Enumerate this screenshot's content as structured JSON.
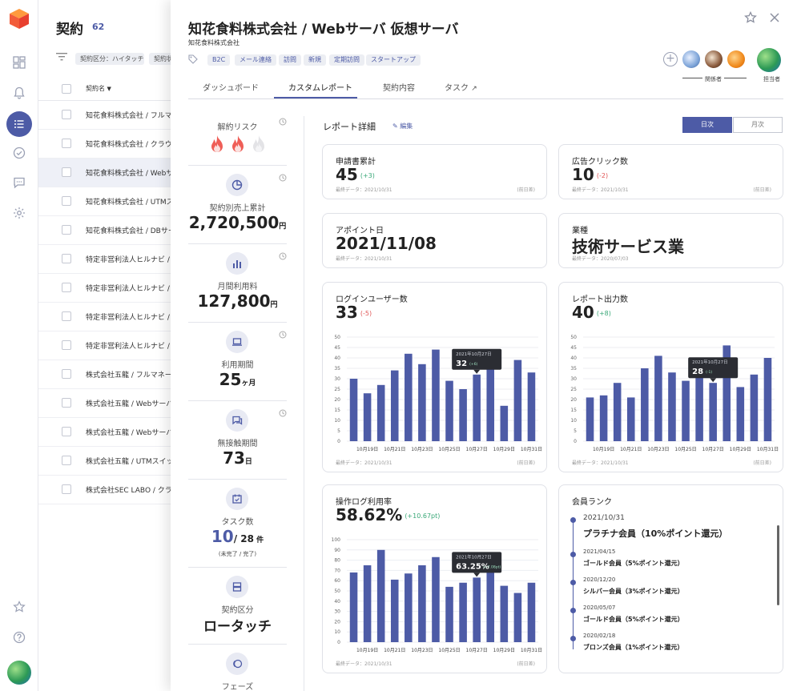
{
  "sidebar": {
    "icons": [
      "logo-cube-icon",
      "dashboard-grid-icon",
      "bell-icon",
      "list-icon",
      "check-circle-icon",
      "chat-icon",
      "gear-icon",
      "star-icon",
      "help-icon",
      "user-avatar"
    ]
  },
  "list": {
    "title": "契約",
    "count": "62",
    "filters": [
      "契約区分：ハイタッチ",
      "契約状"
    ],
    "column_header": "契約名",
    "rows": [
      "知花食料株式会社 / フルマネ",
      "知花食料株式会社 / クラウ",
      "知花食料株式会社 / Webサ",
      "知花食料株式会社 / UTMス",
      "知花食料株式会社 / DBサー",
      "特定非営利法人ヒルナビ / ",
      "特定非営利法人ヒルナビ / ",
      "特定非営利法人ヒルナビ / ",
      "特定非営利法人ヒルナビ / ",
      "株式会社五龍 / フルマネー",
      "株式会社五龍 / Webサーバ",
      "株式会社五龍 / Webサーバ",
      "株式会社五龍 / UTMスイッ",
      "株式会社SEC LABO / クラウ"
    ],
    "selected_index": 2
  },
  "panel": {
    "title": "知花食料株式会社 / Webサーバ 仮想サーバ",
    "company": "知花食料株式会社",
    "tags": [
      "B2C",
      "メール連絡",
      "訪問",
      "新規",
      "定期訪問",
      "スタートアップ"
    ],
    "stakeholders_label": "関係者",
    "manager_label": "担当者",
    "tabs": [
      "ダッシュボード",
      "カスタムレポート",
      "契約内容",
      "タスク"
    ],
    "active_tab": 1
  },
  "metrics": {
    "risk": {
      "label": "解約リスク",
      "level": 2,
      "max": 3
    },
    "sales": {
      "label": "契約別売上累計",
      "value": "2,720,500",
      "unit": "円"
    },
    "monthly": {
      "label": "月間利用料",
      "value": "127,800",
      "unit": "円"
    },
    "period": {
      "label": "利用期間",
      "value": "25",
      "unit": "ヶ月"
    },
    "nocontact": {
      "label": "無接触期間",
      "value": "73",
      "unit": "日"
    },
    "tasks": {
      "label": "タスク数",
      "value": "10",
      "total": "/ 28",
      "unit": "件",
      "note": "(未完了 / 完了)"
    },
    "contract_type": {
      "label": "契約区分",
      "value": "ロータッチ"
    },
    "phase": {
      "label": "フェーズ"
    }
  },
  "report": {
    "title": "レポート詳細",
    "edit": "編集",
    "toggle_day": "日次",
    "toggle_month": "月次",
    "cards": {
      "applications": {
        "label": "申請書累計",
        "value": "45",
        "delta": "(+3)",
        "foot": "最終データ：2021/10/31",
        "foot2": "(前日差)"
      },
      "ad_clicks": {
        "label": "広告クリック数",
        "value": "10",
        "delta": "(-2)",
        "foot": "最終データ：2021/10/31",
        "foot2": "(前日差)"
      },
      "appointment": {
        "label": "アポイント日",
        "value": "2021/11/08",
        "foot": "最終データ：2021/10/31"
      },
      "industry": {
        "label": "業種",
        "value": "技術サービス業",
        "foot": "最終データ：2020/07/03"
      },
      "login": {
        "label": "ログインユーザー数",
        "value": "33",
        "delta": "(-5)",
        "foot": "最終データ：2021/10/31",
        "foot2": "(前日差)"
      },
      "reports": {
        "label": "レポート出力数",
        "value": "40",
        "delta": "(+8)",
        "foot": "最終データ：2021/10/31",
        "foot2": "(前日差)"
      },
      "oplog": {
        "label": "操作ログ利用率",
        "value": "58.62%",
        "delta": "(+10.67pt)",
        "foot": "最終データ：2021/10/31",
        "foot2": "(前日差)"
      },
      "rank": {
        "label": "会員ランク",
        "items": [
          {
            "date": "2021/10/31",
            "name": "プラチナ会員（10%ポイント還元）"
          },
          {
            "date": "2021/04/15",
            "name": "ゴールド会員（5%ポイント還元）"
          },
          {
            "date": "2020/12/20",
            "name": "シルバー会員（3%ポイント還元）"
          },
          {
            "date": "2020/05/07",
            "name": "ゴールド会員（5%ポイント還元）"
          },
          {
            "date": "2020/02/18",
            "name": "ブロンズ会員（1%ポイント還元）"
          }
        ]
      }
    }
  },
  "chart_data": [
    {
      "type": "bar",
      "title": "ログインユーザー数",
      "categories": [
        "10月18日",
        "10月19日",
        "10月20日",
        "10月21日",
        "10月22日",
        "10月23日",
        "10月24日",
        "10月25日",
        "10月26日",
        "10月27日",
        "10月28日",
        "10月29日",
        "10月30日",
        "10月31日"
      ],
      "tick_labels": [
        "10月19日",
        "10月21日",
        "10月23日",
        "10月25日",
        "10月27日",
        "10月29日",
        "10月31日"
      ],
      "values": [
        30,
        23,
        27,
        34,
        42,
        37,
        44,
        29,
        25,
        32,
        38,
        17,
        39,
        33
      ],
      "ylim": [
        0,
        50
      ],
      "yticks": [
        0,
        5,
        10,
        15,
        20,
        25,
        30,
        35,
        40,
        45,
        50
      ],
      "tooltip": {
        "index": 9,
        "date": "2021年10月27日",
        "value": "32",
        "delta": "(+6)"
      },
      "color": "#4d5ba6"
    },
    {
      "type": "bar",
      "title": "レポート出力数",
      "categories": [
        "10月18日",
        "10月19日",
        "10月20日",
        "10月21日",
        "10月22日",
        "10月23日",
        "10月24日",
        "10月25日",
        "10月26日",
        "10月27日",
        "10月28日",
        "10月29日",
        "10月30日",
        "10月31日"
      ],
      "tick_labels": [
        "10月19日",
        "10月21日",
        "10月23日",
        "10月25日",
        "10月27日",
        "10月29日",
        "10月31日"
      ],
      "values": [
        21,
        22,
        28,
        21,
        35,
        41,
        33,
        29,
        34,
        28,
        46,
        26,
        32,
        40
      ],
      "ylim": [
        0,
        50
      ],
      "yticks": [
        0,
        5,
        10,
        15,
        20,
        25,
        30,
        35,
        40,
        45,
        50
      ],
      "tooltip": {
        "index": 9,
        "date": "2021年10月27日",
        "value": "28",
        "delta": "(-1)"
      },
      "color": "#4d5ba6"
    },
    {
      "type": "bar",
      "title": "操作ログ利用率",
      "categories": [
        "10月18日",
        "10月19日",
        "10月20日",
        "10月21日",
        "10月22日",
        "10月23日",
        "10月24日",
        "10月25日",
        "10月26日",
        "10月27日",
        "10月28日",
        "10月29日",
        "10月30日",
        "10月31日"
      ],
      "tick_labels": [
        "10月19日",
        "10月21日",
        "10月23日",
        "10月25日",
        "10月27日",
        "10月29日",
        "10月31日"
      ],
      "values": [
        68,
        75,
        90,
        61,
        67,
        75,
        83,
        54,
        58,
        63,
        71,
        55,
        48,
        58
      ],
      "ylim": [
        0,
        100
      ],
      "yticks": [
        0,
        10,
        20,
        30,
        40,
        50,
        60,
        70,
        80,
        90,
        100
      ],
      "tooltip": {
        "index": 9,
        "date": "2021年10月27日",
        "value": "63.25%",
        "delta": "(+7.08pt)"
      },
      "color": "#4d5ba6"
    }
  ]
}
